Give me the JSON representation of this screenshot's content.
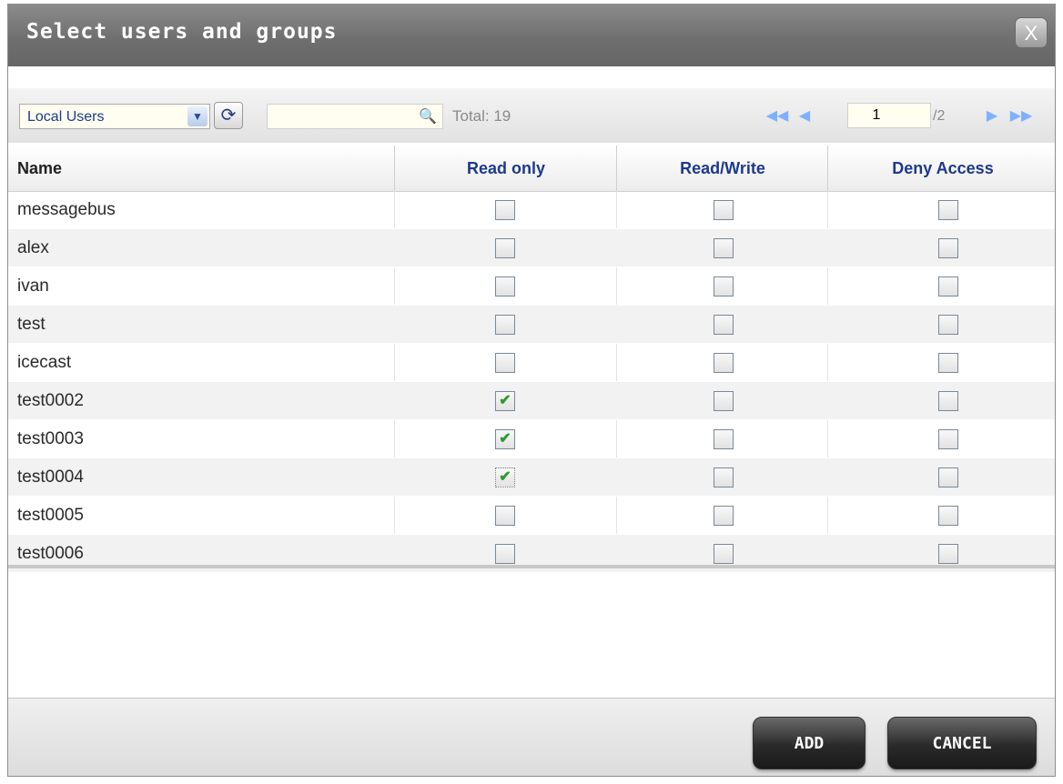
{
  "dialog": {
    "title": "Select users and groups",
    "close_glyph": "X"
  },
  "toolbar": {
    "scope_selected": "Local Users",
    "search_value": "",
    "total_text": "Total: 19",
    "page_current": "1",
    "page_total": "/2"
  },
  "table": {
    "columns": [
      "Name",
      "Read only",
      "Read/Write",
      "Deny Access"
    ],
    "rows": [
      {
        "name": "messagebus",
        "read_only": false,
        "read_write": false,
        "deny": false
      },
      {
        "name": "alex",
        "read_only": false,
        "read_write": false,
        "deny": false
      },
      {
        "name": "ivan",
        "read_only": false,
        "read_write": false,
        "deny": false
      },
      {
        "name": "test",
        "read_only": false,
        "read_write": false,
        "deny": false
      },
      {
        "name": "icecast",
        "read_only": false,
        "read_write": false,
        "deny": false
      },
      {
        "name": "test0002",
        "read_only": true,
        "read_write": false,
        "deny": false
      },
      {
        "name": "test0003",
        "read_only": true,
        "read_write": false,
        "deny": false
      },
      {
        "name": "test0004",
        "read_only": true,
        "read_write": false,
        "deny": false
      },
      {
        "name": "test0005",
        "read_only": false,
        "read_write": false,
        "deny": false
      },
      {
        "name": "test0006",
        "read_only": false,
        "read_write": false,
        "deny": false
      }
    ]
  },
  "footer": {
    "add_label": "ADD",
    "cancel_label": "CANCEL"
  },
  "icons": {
    "dropdown": "chevron-down-icon",
    "refresh": "refresh-icon",
    "search": "search-icon",
    "first": "first-page-icon",
    "prev": "prev-page-icon",
    "next": "next-page-icon",
    "last": "last-page-icon",
    "check": "checkmark-icon"
  }
}
